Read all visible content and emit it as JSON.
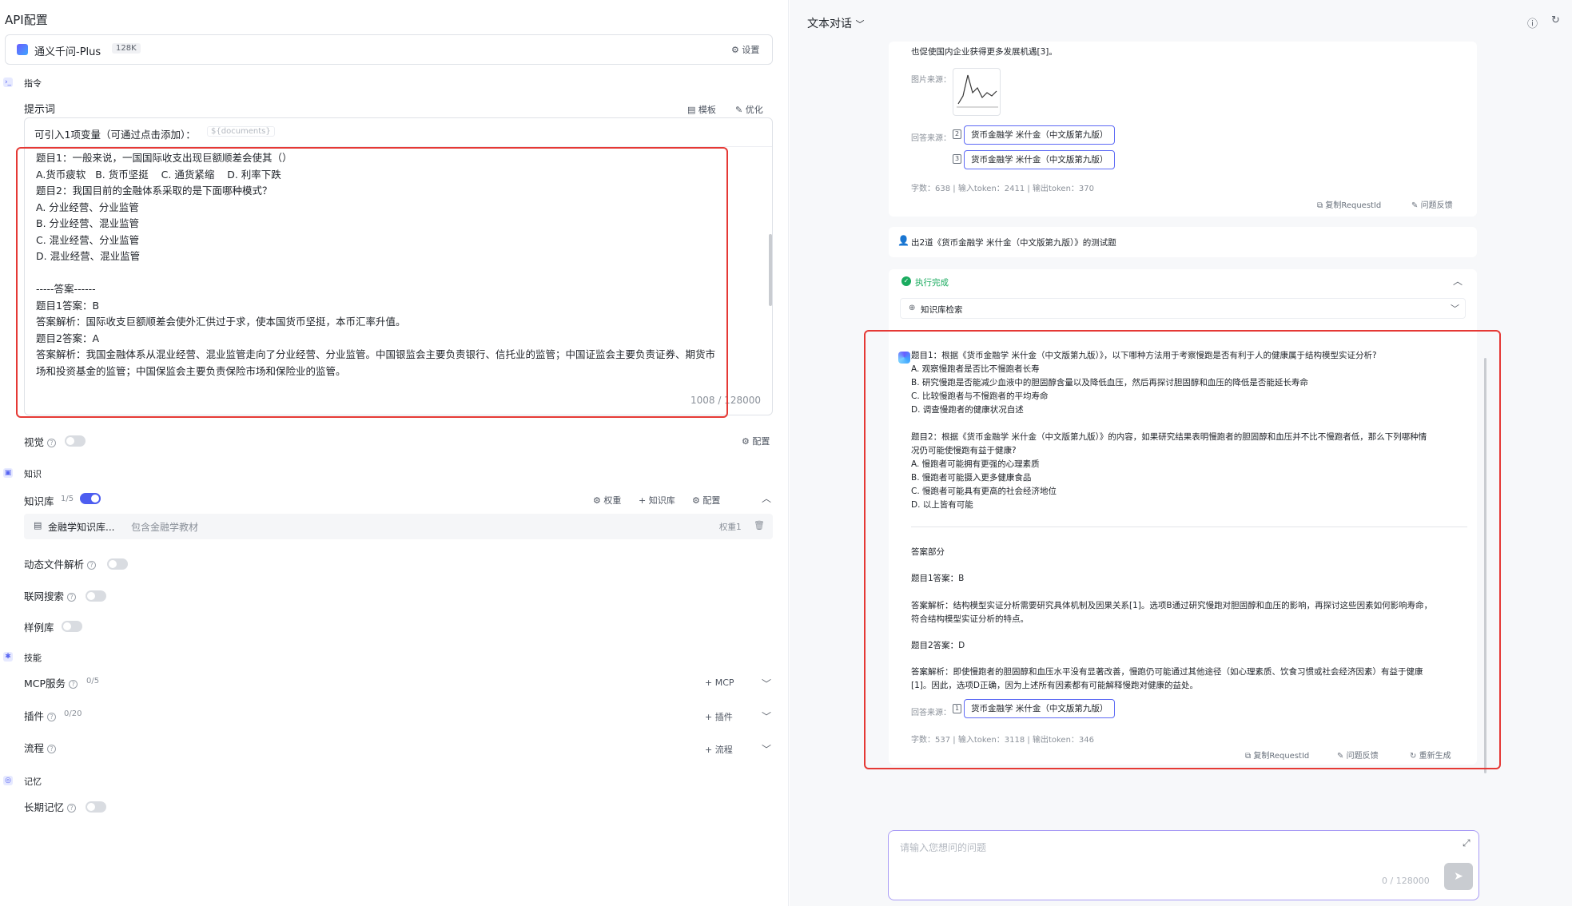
{
  "left": {
    "title": "API配置",
    "model": {
      "name": "通义千问-Plus",
      "ctx": "128K",
      "settings_label": "设置"
    },
    "instruction_section": "指令",
    "prompt_label": "提示词",
    "template_label": "模板",
    "optimize_label": "优化",
    "variables_hint": "可引入1项变量（可通过点击添加）：",
    "variable_tag": "${documents}",
    "prompt_lines": [
      "题目1：一般来说，一国国际收支出现巨额顺差会使其（）",
      "A.货币疲软   B. 货币坚挺    C. 通货紧缩    D. 利率下跌",
      "题目2：我国目前的金融体系采取的是下面哪种模式？",
      "A. 分业经营、分业监管",
      "B. 分业经营、混业监管",
      "C. 混业经营、分业监管",
      "D. 混业经营、混业监管",
      "",
      "-----答案------",
      "题目1答案：B",
      "答案解析：国际收支巨额顺差会使外汇供过于求，使本国货币坚挺，本币汇率升值。",
      "题目2答案：A",
      "答案解析：我国金融体系从混业经营、混业监管走向了分业经营、分业监管。中国银监会主要负责银行、信托业的监管；中国证监会主要负责证券、期货市",
      "场和投资基金的监管；中国保监会主要负责保险市场和保险业的监管。"
    ],
    "char_count": "1008 / 128000",
    "vision_label": "视觉",
    "vision_config": "配置",
    "knowledge_section": "知识",
    "kb_label": "知识库",
    "kb_count": "1/5",
    "kb_weight": "权重",
    "kb_add": "知识库",
    "kb_config": "配置",
    "kb_item_name": "金融学知识库...",
    "kb_item_desc": "包含金融学教材",
    "kb_item_weight": "权重1",
    "dynamic_file_label": "动态文件解析",
    "web_search_label": "联网搜索",
    "sample_lib_label": "样例库",
    "skills_section": "技能",
    "mcp_label": "MCP服务",
    "mcp_count": "0/5",
    "mcp_add": "MCP",
    "plugin_label": "插件",
    "plugin_count": "0/20",
    "plugin_add": "插件",
    "flow_label": "流程",
    "flow_add": "流程",
    "memory_section": "记忆",
    "longmem_label": "长期记忆"
  },
  "right": {
    "mode_label": "文本对话",
    "prev_tail": "也促使国内企业获得更多发展机遇[3]。",
    "image_source_label": "图片来源：",
    "answer_source_label": "回答来源：",
    "prev_sources": [
      {
        "num": "2",
        "title": "货币金融学 米什金（中文版第九版）"
      },
      {
        "num": "3",
        "title": "货币金融学 米什金（中文版第九版）"
      }
    ],
    "prev_stats": "字数：638  |  输入token：2411  |  输出token：370",
    "copy_request_id": "复制RequestId",
    "feedback": "问题反馈",
    "user_message": "出2道《货币金融学 米什金（中文版第九版）》的测试题",
    "status_done": "执行完成",
    "kb_search": "知识库检索",
    "answer_lines_q": [
      "题目1：根据《货币金融学 米什金（中文版第九版）》，以下哪种方法用于考察慢跑是否有利于人的健康属于结构模型实证分析?",
      "A. 观察慢跑者是否比不慢跑者长寿",
      "B. 研究慢跑是否能减少血液中的胆固醇含量以及降低血压，然后再探讨胆固醇和血压的降低是否能延长寿命",
      "C. 比较慢跑者与不慢跑者的平均寿命",
      "D. 调查慢跑者的健康状况自述",
      "",
      "题目2：根据《货币金融学 米什金（中文版第九版）》的内容，如果研究结果表明慢跑者的胆固醇和血压并不比不慢跑者低，那么下列哪种情",
      "况仍可能使慢跑有益于健康?",
      "A. 慢跑者可能拥有更强的心理素质",
      "B. 慢跑者可能摄入更多健康食品",
      "C. 慢跑者可能具有更高的社会经济地位",
      "D. 以上皆有可能"
    ],
    "answer_part_title": "答案部分",
    "ans1": "题目1答案：B",
    "ans1_expl_1": "答案解析：结构模型实证分析需要研究具体机制及因果关系[1]。选项B通过研究慢跑对胆固醇和血压的影响，再探讨这些因素如何影响寿命，",
    "ans1_expl_2": "符合结构模型实证分析的特点。",
    "ans2": "题目2答案：D",
    "ans2_expl_1": "答案解析：即使慢跑者的胆固醇和血压水平没有显著改善，慢跑仍可能通过其他途径（如心理素质、饮食习惯或社会经济因素）有益于健康",
    "ans2_expl_2": "[1]。因此，选项D正确，因为上述所有因素都有可能解释慢跑对健康的益处。",
    "cur_source": {
      "num": "1",
      "title": "货币金融学 米什金（中文版第九版）"
    },
    "cur_stats": "字数：537  |  输入token：3118  |  输出token：346",
    "regenerate": "重新生成",
    "input_placeholder": "请输入您想问的问题",
    "input_count": "0 / 128000"
  },
  "colors": {
    "accent": "#4d5df0",
    "highlight": "#e53935",
    "success": "#1aab5f"
  }
}
